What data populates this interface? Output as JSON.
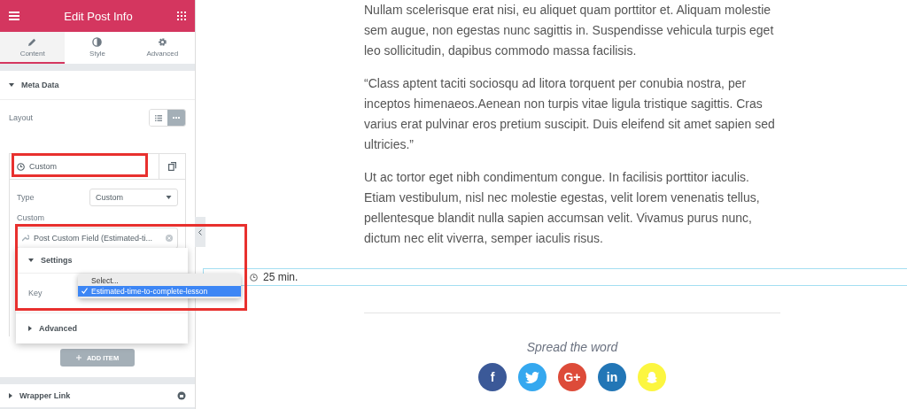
{
  "panel": {
    "title": "Edit Post Info",
    "tabs": [
      {
        "label": "Content",
        "kind": "pencil",
        "selected": true
      },
      {
        "label": "Style",
        "kind": "contrast",
        "selected": false
      },
      {
        "label": "Advanced",
        "kind": "gear",
        "selected": false
      }
    ],
    "section": {
      "title": "Meta Data",
      "expanded": true
    },
    "layout": {
      "label": "Layout",
      "options": [
        {
          "kind": "list",
          "selected": false
        },
        {
          "kind": "inline",
          "selected": true
        }
      ]
    },
    "item": {
      "title": "Custom",
      "type_label": "Type",
      "type_value": "Custom",
      "custom_label": "Custom",
      "field_value": "Post Custom Field (Estimated-ti..."
    },
    "popover": {
      "settings": {
        "title": "Settings",
        "expanded": true
      },
      "key_label": "Key",
      "advanced": {
        "title": "Advanced",
        "expanded": false
      }
    },
    "key_dropdown": {
      "options": [
        {
          "label": "Select...",
          "selected": false
        },
        {
          "label": "Estimated-time-to-complete-lesson",
          "selected": true
        }
      ]
    },
    "add_button": "ADD ITEM",
    "wrapper_link": {
      "title": "Wrapper Link",
      "expanded": false
    }
  },
  "article": {
    "paragraphs": [
      "Nullam scelerisque erat nisi, eu aliquet quam porttitor et. Aliquam molestie sem augue, non egestas nunc sagittis in. Suspendisse vehicula turpis eget leo sollicitudin, dapibus commodo massa facilisis.",
      "“Class aptent taciti sociosqu ad litora torquent per conubia nostra, per inceptos himenaeos.Aenean non turpis vitae ligula tristique sagittis. Cras varius erat pulvinar eros pretium suscipit. Duis eleifend sit amet sapien sed ultricies.”",
      "Ut ac tortor eget nibh condimentum congue. In facilisis porttitor iaculis. Etiam vestibulum, nisl nec molestie egestas, velit lorem venenatis tellus, pellentesque blandit nulla sapien accumsan velit. Vivamus purus nunc, dictum nec elit viverra, semper iaculis risus."
    ],
    "meta": "25 min.",
    "share_title": "Spread the word",
    "share": [
      {
        "kind": "text",
        "glyph": "f",
        "color": "#3b5998"
      },
      {
        "kind": "bird",
        "color": "#35a8ef"
      },
      {
        "kind": "text",
        "glyph": "G+",
        "color": "#dd4b39"
      },
      {
        "kind": "text",
        "glyph": "in",
        "color": "#2276b6"
      },
      {
        "kind": "ghost",
        "color": "#fcf640"
      }
    ]
  }
}
